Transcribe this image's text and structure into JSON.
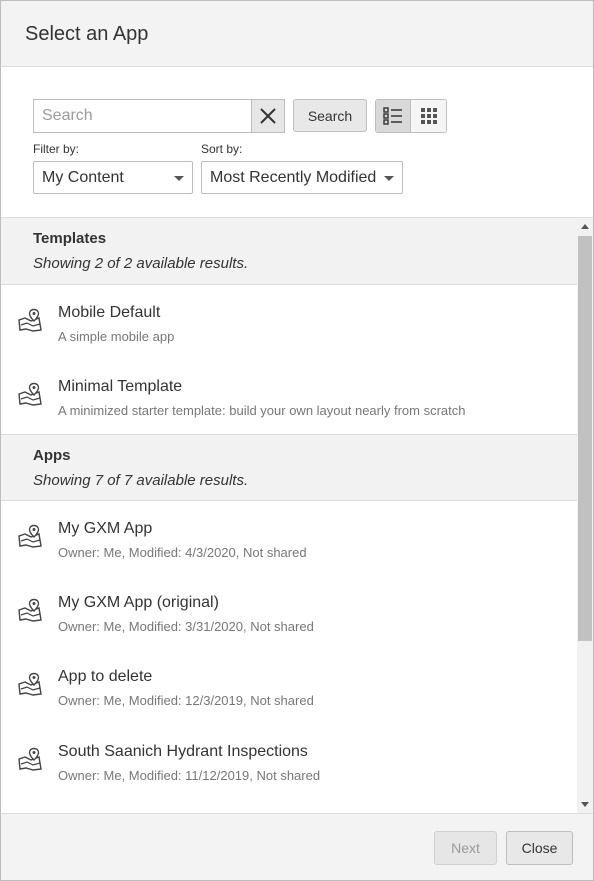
{
  "dialog": {
    "title": "Select an App"
  },
  "toolbar": {
    "search_placeholder": "Search",
    "search_value": "",
    "clear_icon": "close-icon",
    "search_label": "Search",
    "view_list_icon": "list-view-icon",
    "view_grid_icon": "grid-view-icon",
    "filter_label": "Filter by:",
    "filter_value": "My Content",
    "sort_label": "Sort by:",
    "sort_value": "Most Recently Modified"
  },
  "templates": {
    "title": "Templates",
    "count": "Showing 2 of 2 available results.",
    "items": [
      {
        "title": "Mobile Default",
        "subtitle": "A simple mobile app",
        "icon": "map-app-icon"
      },
      {
        "title": "Minimal Template",
        "subtitle": "A minimized starter template: build your own layout nearly from scratch",
        "icon": "map-app-icon"
      }
    ]
  },
  "apps": {
    "title": "Apps",
    "count": "Showing 7 of 7 available results.",
    "items": [
      {
        "title": "My GXM App",
        "subtitle": "Owner: Me, Modified: 4/3/2020, Not shared",
        "icon": "map-app-icon"
      },
      {
        "title": "My GXM App (original)",
        "subtitle": "Owner: Me, Modified: 3/31/2020, Not shared",
        "icon": "map-app-icon"
      },
      {
        "title": "App to delete",
        "subtitle": "Owner: Me, Modified: 12/3/2019, Not shared",
        "icon": "map-app-icon"
      },
      {
        "title": "South Saanich Hydrant Inspections",
        "subtitle": "Owner: Me, Modified: 11/12/2019, Not shared",
        "icon": "map-app-icon"
      }
    ]
  },
  "footer": {
    "next_label": "Next",
    "close_label": "Close"
  },
  "colors": {
    "header_bg": "#f3f3f3",
    "section_bg": "#f2f2f2",
    "border": "#bdbdbd"
  }
}
